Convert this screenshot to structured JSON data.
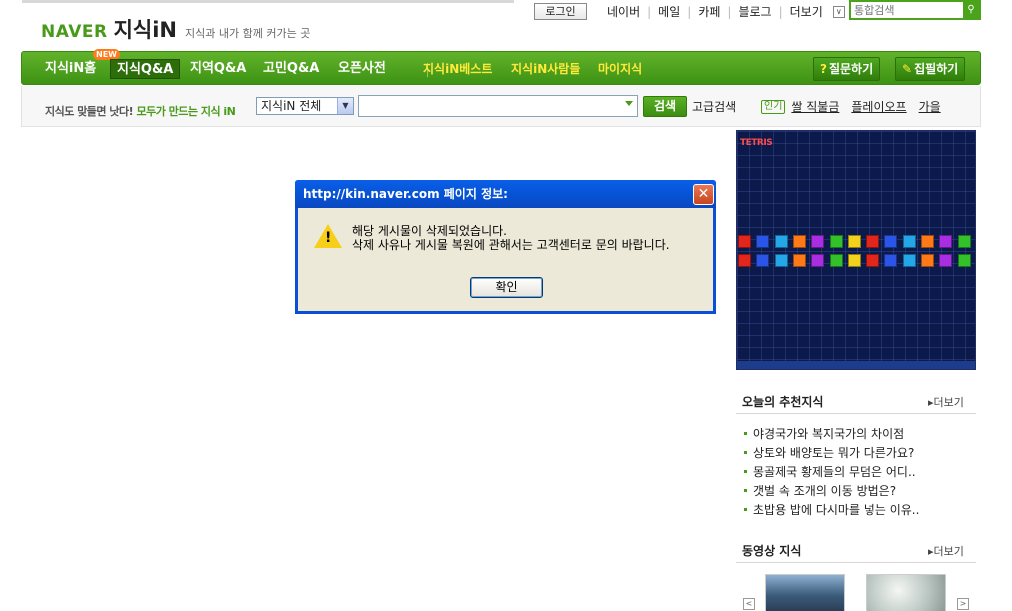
{
  "header": {
    "brand": "NAVER",
    "service": "지식iN",
    "slogan": "지식과 내가 함께 커가는 곳",
    "login_label": "로그인",
    "links": [
      "네이버",
      "메일",
      "카페",
      "블로그",
      "더보기"
    ],
    "more_indicator": "∨",
    "search_placeholder": "통합검색"
  },
  "nav": {
    "badge": "NEW",
    "items": [
      "지식iN홈",
      "지식Q&A",
      "지역Q&A",
      "고민Q&A",
      "오픈사전"
    ],
    "sub_items": [
      "지식iN베스트",
      "지식iN사람들",
      "마이지식"
    ],
    "ask_label": "질문하기",
    "write_label": "집필하기"
  },
  "search": {
    "tagline_prefix": "지식도 맞들면 낫다! ",
    "tagline_highlight": "모두가 만드는 지식 iN",
    "scope_selected": "지식iN 전체",
    "query": "",
    "button": "검색",
    "advanced": "고급검색",
    "popular_badge": "인기",
    "popular_keywords": [
      "쌀 직불금",
      "플레이오프",
      "가을"
    ]
  },
  "game": {
    "logo": "TETRIS",
    "colors": [
      "#e2261c",
      "#2a55e6",
      "#23a7e8",
      "#ff7a16",
      "#a92ee2",
      "#33c12a",
      "#f2d21a",
      "#e2261c",
      "#2a55e6",
      "#23a7e8",
      "#ff7a16",
      "#a92ee2",
      "#33c12a"
    ]
  },
  "sidebar": {
    "recommended": {
      "title": "오늘의 추천지식",
      "more": "더보기",
      "items": [
        "야경국가와 복지국가의 차이점",
        "상토와 배양토는 뭐가 다른가요?",
        "몽골제국 황제들의 무덤은 어디..",
        "갯벌 속 조개의 이동 방법은?",
        "초밥용 밥에 다시마를 넣는 이유.."
      ]
    },
    "video": {
      "title": "동영상 지식",
      "more": "더보기",
      "prev": "<",
      "next": ">"
    }
  },
  "dialog": {
    "title": "http://kin.naver.com 페이지 정보:",
    "line1": "해당 게시물이 삭제되었습니다.",
    "line2": "삭제 사유나 게시물 복원에 관해서는 고객센터로 문의 바랍니다.",
    "ok_label": "확인",
    "close_glyph": "✕"
  }
}
